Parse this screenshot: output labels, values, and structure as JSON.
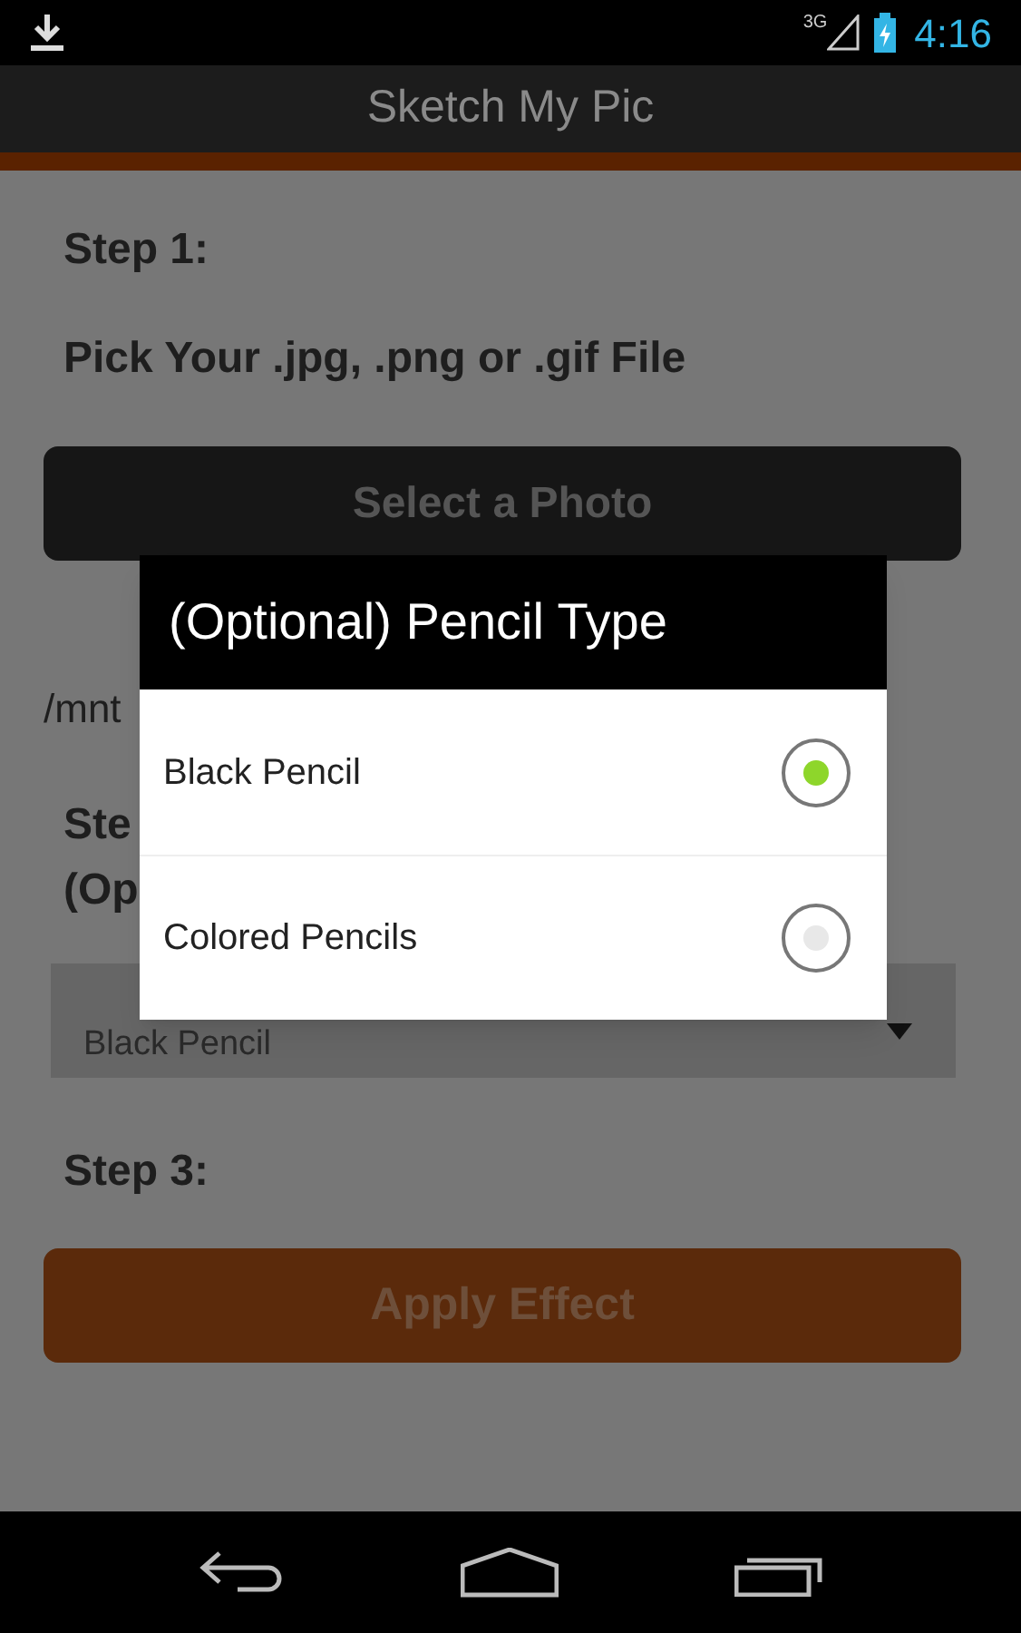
{
  "status_bar": {
    "time": "4:16",
    "network": "3G"
  },
  "app_bar": {
    "title": "Sketch My Pic"
  },
  "content": {
    "step1_label": "Step 1:",
    "step1_text": "Pick Your .jpg, .png or .gif File",
    "select_button": "Select a Photo",
    "file_path": "/mnt",
    "step2_label": "Ste",
    "step2_note": "(Op",
    "pencil_dropdown": "Black Pencil",
    "step3_label": "Step 3:",
    "apply_button": "Apply Effect"
  },
  "dialog": {
    "title": "(Optional) Pencil Type",
    "options": [
      {
        "label": "Black Pencil",
        "selected": true
      },
      {
        "label": "Colored Pencils",
        "selected": false
      }
    ]
  }
}
